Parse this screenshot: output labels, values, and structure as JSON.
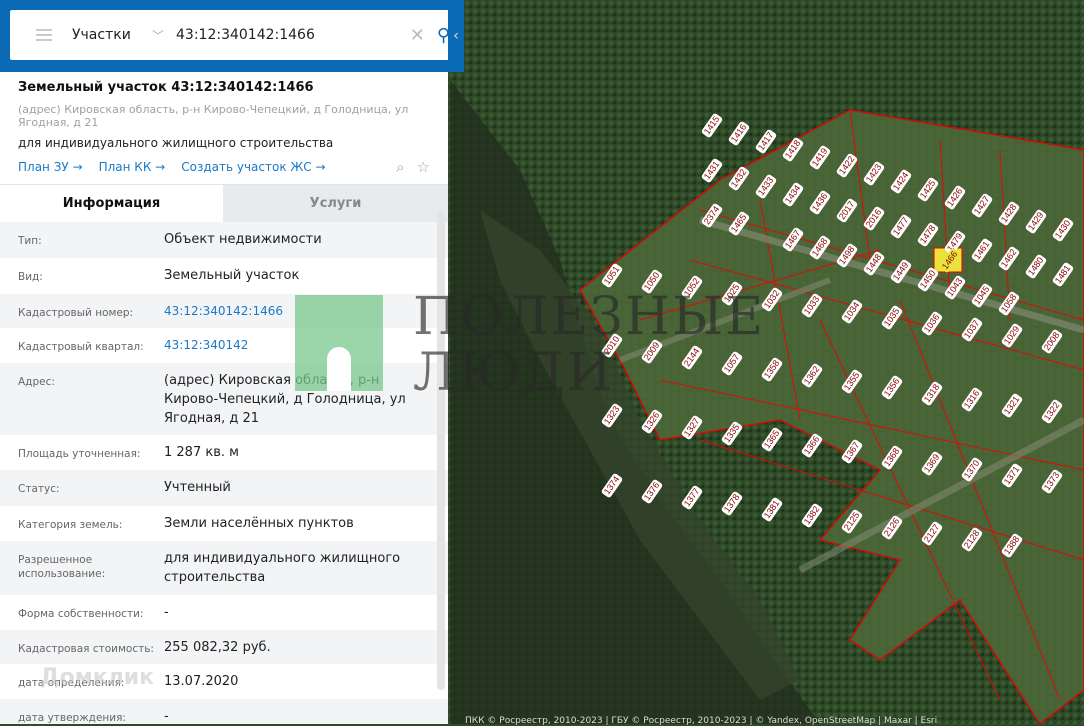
{
  "search": {
    "category": "Участки",
    "query": "43:12:340142:1466"
  },
  "object": {
    "title": "Земельный участок 43:12:340142:1466",
    "address": "(адрес) Кировская область, р-н Кирово-Чепецкий, д Голодница, ул Ягодная, д 21",
    "use": "для индивидуального жилищного строительства"
  },
  "links": [
    "План ЗУ →",
    "План КК →",
    "Создать участок ЖС →"
  ],
  "tabs": [
    "Информация",
    "Услуги"
  ],
  "rows": [
    {
      "label": "Тип:",
      "value": "Объект недвижимости"
    },
    {
      "label": "Вид:",
      "value": "Земельный участок"
    },
    {
      "label": "Кадастровый номер:",
      "value": "43:12:340142:1466"
    },
    {
      "label": "Кадастровый квартал:",
      "value": "43:12:340142"
    },
    {
      "label": "Адрес:",
      "value": "(адрес) Кировская область, р-н Кирово-Чепецкий, д Голодница, ул Ягодная, д 21"
    },
    {
      "label": "Площадь уточненная:",
      "value": "1 287 кв. м"
    },
    {
      "label": "Статус:",
      "value": "Учтенный"
    },
    {
      "label": "Категория земель:",
      "value": "Земли населённых пунктов"
    },
    {
      "label": "Разрешенное использование:",
      "value": "для индивидуального жилищного строительства"
    },
    {
      "label": "Форма собственности:",
      "value": "-"
    },
    {
      "label": "Кадастровая стоимость:",
      "value": "255 082,32 руб."
    },
    {
      "label": "дата определения:",
      "value": "13.07.2020"
    },
    {
      "label": "дата утверждения:",
      "value": "-"
    }
  ],
  "watermark": {
    "line1": "ПОЛЕЗНЫЕ",
    "line2": "ЛЮДИ"
  },
  "domclick": "Домклик",
  "map": {
    "copyright": "ПКК © Росреестр, 2010-2023 | ГБУ © Росреестр, 2010-2023 | © Yandex, OpenStreetMap | Maxar | Esri",
    "parcels": [
      "1415",
      "1416",
      "1417",
      "1418",
      "1419",
      "1422",
      "1423",
      "1424",
      "1425",
      "1426",
      "1427",
      "1428",
      "1429",
      "1430",
      "1431",
      "1432",
      "1433",
      "1434",
      "1436",
      "2017",
      "2016",
      "1477",
      "1478",
      "1479",
      "1461",
      "1462",
      "1480",
      "1481",
      "2374",
      "1465",
      "1466",
      "1467",
      "1468",
      "1498",
      "1448",
      "1449",
      "1450",
      "1043",
      "1045",
      "1058",
      "1051",
      "1050",
      "1052",
      "1025",
      "1032",
      "1033",
      "1034",
      "1035",
      "1036",
      "1037",
      "1029",
      "2008",
      "2010",
      "2009",
      "2144",
      "1057",
      "1358",
      "1362",
      "1355",
      "1356",
      "1318",
      "1316",
      "1321",
      "1322",
      "1323",
      "1326",
      "1327",
      "1335",
      "1365",
      "1366",
      "1367",
      "1368",
      "1369",
      "1370",
      "1371",
      "1373",
      "1374",
      "1376",
      "1377",
      "1378",
      "1381",
      "1382",
      "2125",
      "2126",
      "2127",
      "2128",
      "1388"
    ],
    "selected": "1466"
  }
}
